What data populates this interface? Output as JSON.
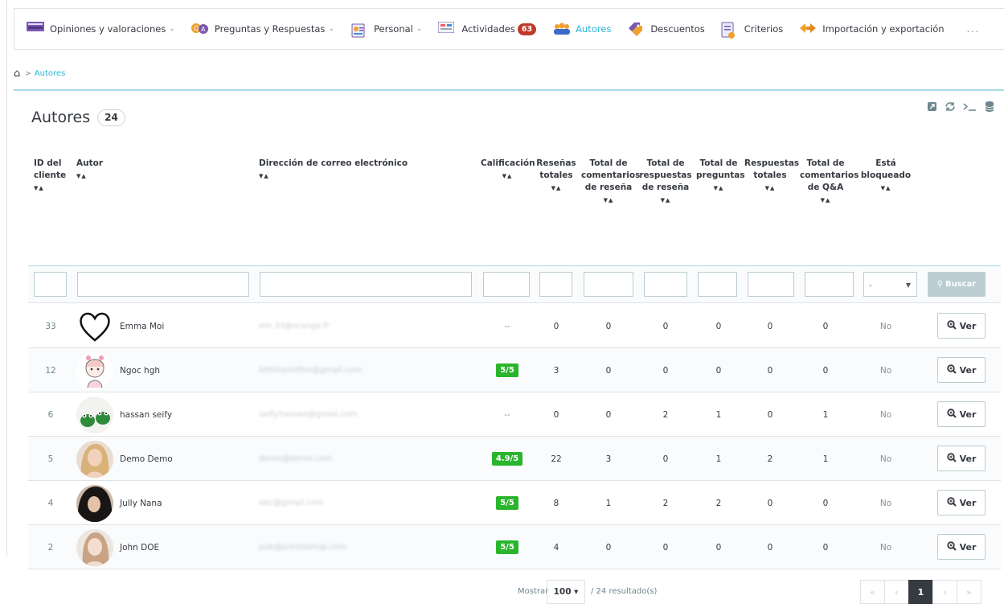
{
  "nav": {
    "items": [
      {
        "label": "Opiniones y valoraciones",
        "icon": "keyboard-icon",
        "chevron": true
      },
      {
        "label": "Preguntas y Respuestas",
        "icon": "qa-icon",
        "chevron": true
      },
      {
        "label": "Personal",
        "icon": "personal-icon",
        "chevron": true
      },
      {
        "label": "Actividades",
        "icon": "activities-icon",
        "badge": "63"
      },
      {
        "label": "Autores",
        "icon": "authors-icon",
        "active": true
      },
      {
        "label": "Descuentos",
        "icon": "discount-icon"
      },
      {
        "label": "Criterios",
        "icon": "criteria-icon"
      },
      {
        "label": "Importación y exportación",
        "icon": "import-export-icon"
      }
    ],
    "more": "..."
  },
  "breadcrumb": {
    "home_icon": "home-icon",
    "separator": ">",
    "current": "Autores"
  },
  "panel": {
    "title": "Autores",
    "count": "24",
    "tools": [
      "export-icon",
      "refresh-icon",
      "terminal-icon",
      "database-icon"
    ]
  },
  "table": {
    "headers": {
      "id": "ID del cliente",
      "author": "Autor",
      "email": "Dirección de correo electrónico",
      "rating": "Calificación",
      "reviews": "Reseñas totales",
      "review_comments": "Total de comentarios de reseña",
      "review_replies": "Total de respuestas de reseña",
      "questions": "Total de preguntas",
      "answers": "Respuestas totales",
      "qa_comments": "Total de comentarios de Q&A",
      "blocked": "Está bloqueado"
    },
    "sort_glyph": "▼▲",
    "filter": {
      "blocked_value": "-",
      "search_label": "Buscar"
    },
    "rows": [
      {
        "id": "33",
        "name": "Emma Moi",
        "avatar": "heart",
        "email": "em.33@orange.fr",
        "rating": "--",
        "reviews": "0",
        "review_comments": "0",
        "review_replies": "0",
        "questions": "0",
        "answers": "0",
        "qa_comments": "0",
        "blocked": "No",
        "view": "Ver"
      },
      {
        "id": "12",
        "name": "Ngoc hgh",
        "avatar": "girl",
        "email": "lethihanhfilm@gmail.com",
        "rating": "5/5",
        "reviews": "3",
        "review_comments": "0",
        "review_replies": "0",
        "questions": "0",
        "answers": "0",
        "qa_comments": "0",
        "blocked": "No",
        "view": "Ver"
      },
      {
        "id": "6",
        "name": "hassan seify",
        "avatar": "frogs",
        "email": "seify.hassan@gmail.com",
        "rating": "--",
        "reviews": "0",
        "review_comments": "0",
        "review_replies": "2",
        "questions": "1",
        "answers": "0",
        "qa_comments": "1",
        "blocked": "No",
        "view": "Ver"
      },
      {
        "id": "5",
        "name": "Demo Demo",
        "avatar": "blonde",
        "email": "demo@demo.com",
        "rating": "4.9/5",
        "reviews": "22",
        "review_comments": "3",
        "review_replies": "0",
        "questions": "1",
        "answers": "2",
        "qa_comments": "1",
        "blocked": "No",
        "view": "Ver"
      },
      {
        "id": "4",
        "name": "Jully Nana",
        "avatar": "dark",
        "email": "abc@gmail.com",
        "rating": "5/5",
        "reviews": "8",
        "review_comments": "1",
        "review_replies": "2",
        "questions": "2",
        "answers": "0",
        "qa_comments": "0",
        "blocked": "No",
        "view": "Ver"
      },
      {
        "id": "2",
        "name": "John DOE",
        "avatar": "woman",
        "email": "pub@prestashop.com",
        "rating": "5/5",
        "reviews": "4",
        "review_comments": "0",
        "review_replies": "0",
        "questions": "0",
        "answers": "0",
        "qa_comments": "0",
        "blocked": "No",
        "view": "Ver"
      }
    ]
  },
  "footer": {
    "show_label": "Mostrar",
    "per_page": "100 ▾",
    "results": "/ 24 resultado(s)",
    "pagination": [
      "«",
      "‹",
      "1",
      "›",
      "»"
    ],
    "current_page": "1"
  },
  "colors": {
    "accent": "#25b9d7",
    "rating_green": "#2ab52d",
    "badge_red": "#c0392b"
  }
}
